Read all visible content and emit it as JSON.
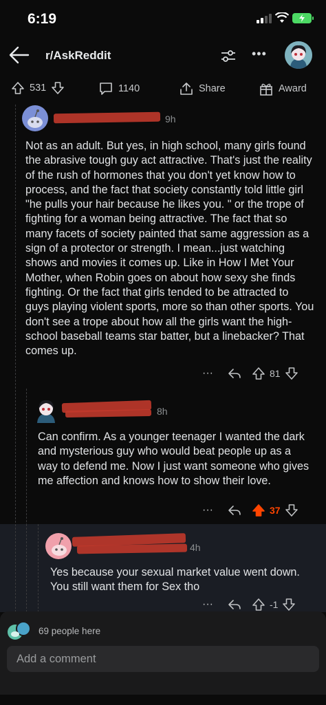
{
  "status": {
    "time": "6:19"
  },
  "header": {
    "subreddit": "r/AskReddit"
  },
  "actions": {
    "upvotes": "531",
    "comments": "1140",
    "share": "Share",
    "award": "Award"
  },
  "comments": [
    {
      "time": "9h",
      "text": "Not as an adult. But yes, in high school, many girls found the abrasive tough guy act attractive. That's just the reality of the rush of hormones that you don't yet know how to process, and the fact that society constantly told little girl \"he pulls your hair because he likes you. \" or the trope of fighting for a woman being attractive. The fact that so many facets of society painted that same aggression as a sign of a protector or strength. I mean...just watching shows and movies it comes up. Like in How I Met Your Mother, when Robin goes on about how sexy she finds fighting. Or the fact that girls tended to be attracted to guys playing violent sports, more so than other sports. You don't see a trope about how all the girls want the high-school baseball teams star batter, but a linebacker? That comes up.",
      "score": "81",
      "more": "···"
    },
    {
      "time": "8h",
      "text": "Can confirm. As a younger teenager I wanted the dark and mysterious guy who would beat people up as a way to defend me. Now I just want someone who gives me affection and knows how to show their love.",
      "score": "37",
      "more": "···"
    },
    {
      "time": "4h",
      "text": "Yes because your sexual market value went down. You still want them for Sex tho",
      "score": "-1",
      "more": "···"
    }
  ],
  "footer": {
    "people_here": "69 people here",
    "comment_placeholder": "Add a comment"
  },
  "colors": {
    "upvote_active": "#ff4500",
    "redaction": "#c0392b",
    "background": "#0b0b0b"
  }
}
